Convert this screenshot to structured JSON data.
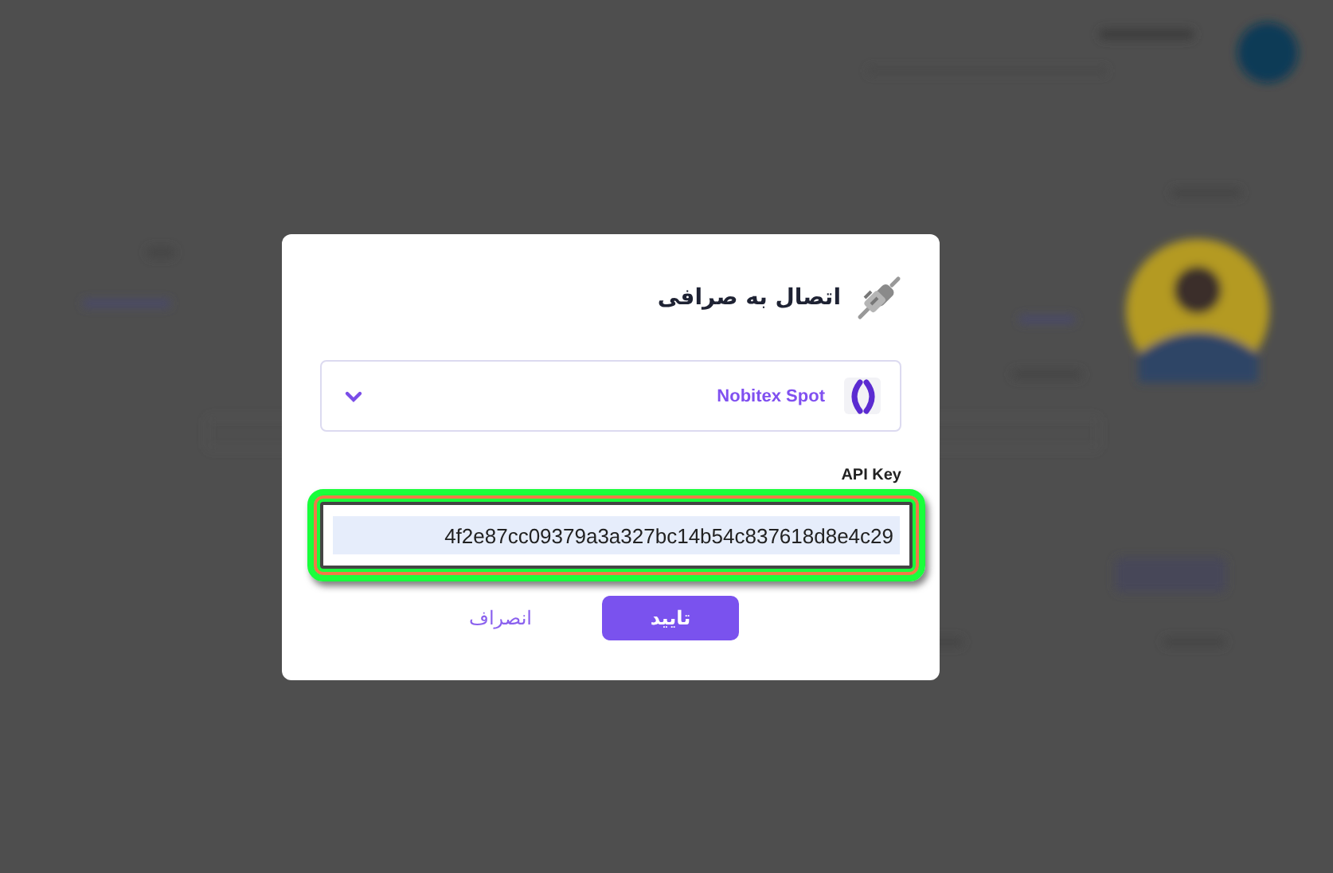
{
  "dialog": {
    "title": "اتصال به صرافی",
    "exchange_select": {
      "value": "Nobitex Spot"
    },
    "api_key": {
      "label": "API Key",
      "value": "4f2e87cc09379a3a327bc14b54c837618d8e4c29",
      "highlighted": true
    },
    "buttons": [
      {
        "label": "تایید",
        "kind": "primary"
      },
      {
        "label": "انصراف",
        "kind": "text"
      }
    ]
  }
}
